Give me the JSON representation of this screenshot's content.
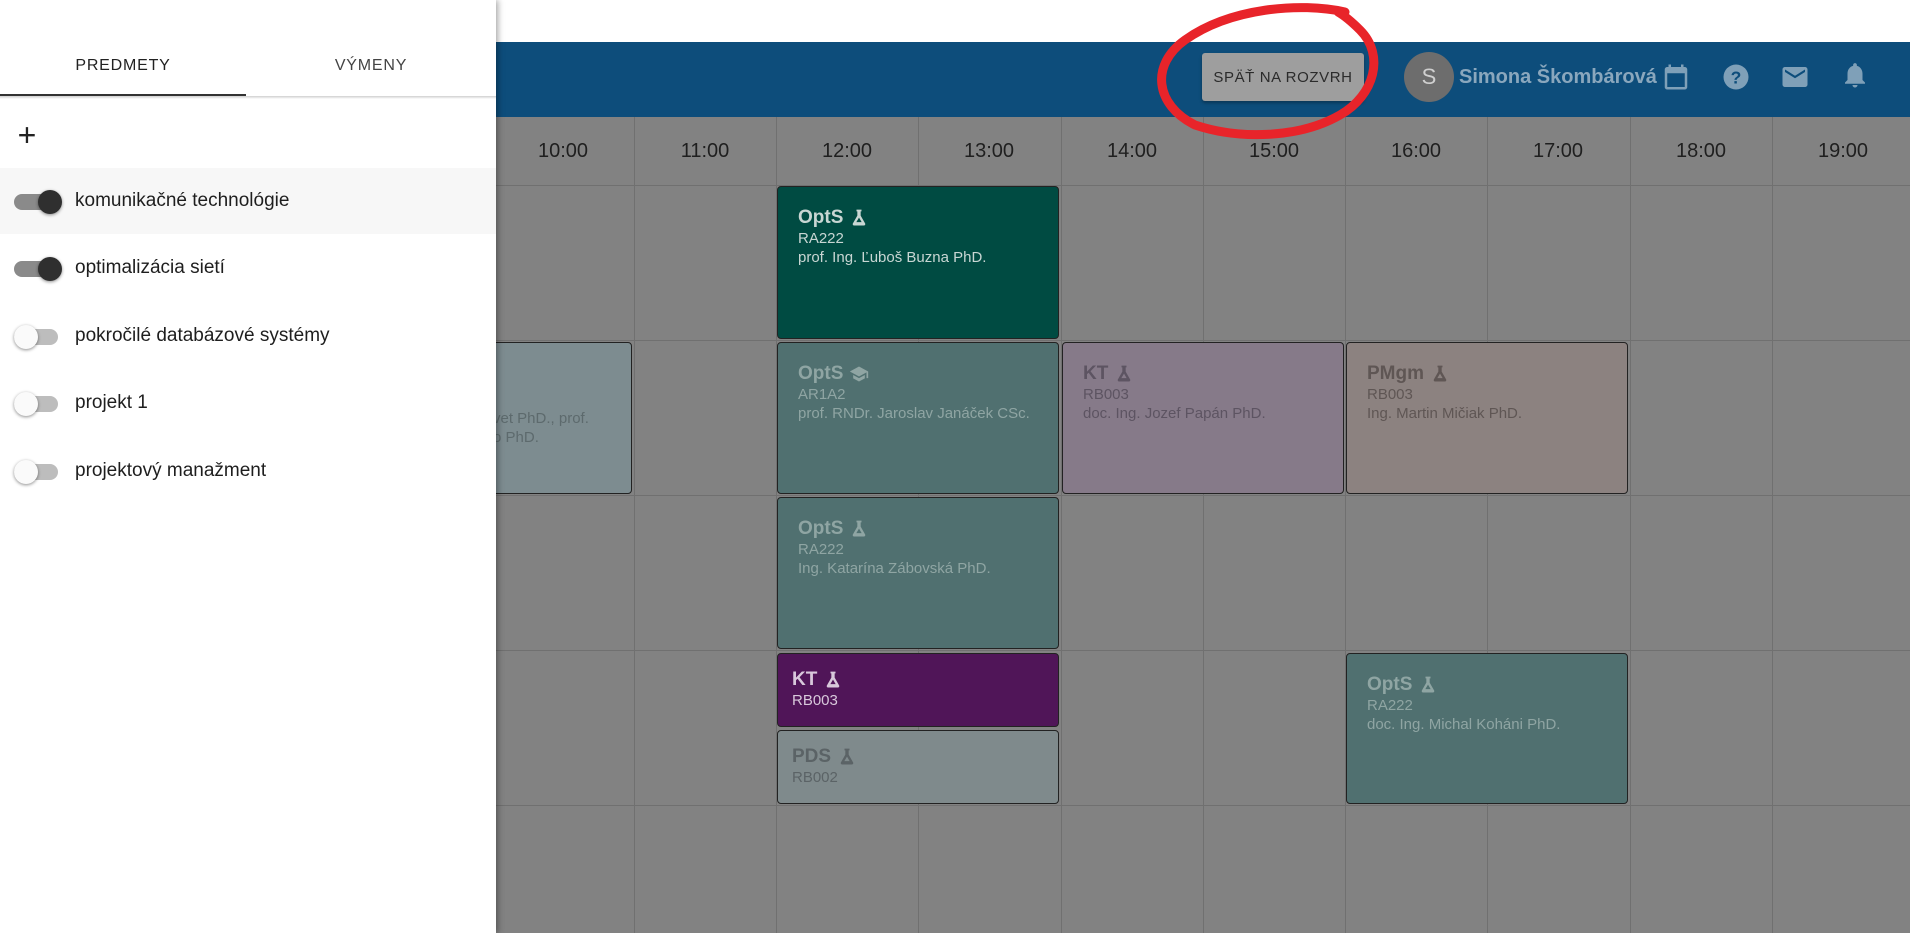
{
  "header": {
    "back_label": "SPÄŤ NA ROZVRH",
    "user_initial": "S",
    "user_name": "Simona Škombárová",
    "icons": [
      "calendar-icon",
      "help-icon",
      "mail-icon",
      "bell-icon"
    ],
    "bar_color": "#0d4d7b"
  },
  "drawer": {
    "tabs": [
      {
        "label": "PREDMETY",
        "active": true
      },
      {
        "label": "VÝMENY",
        "active": false
      }
    ],
    "add_label": "+",
    "subjects": [
      {
        "label": "komunikačné technológie",
        "enabled": true
      },
      {
        "label": "optimalizácia sietí",
        "enabled": true
      },
      {
        "label": "pokročilé databázové systémy",
        "enabled": false
      },
      {
        "label": "projekt 1",
        "enabled": false
      },
      {
        "label": "projektový manažment",
        "enabled": false
      }
    ]
  },
  "timetable": {
    "hours": [
      "10:00",
      "11:00",
      "12:00",
      "13:00",
      "14:00",
      "15:00",
      "16:00",
      "17:00",
      "18:00",
      "19:00"
    ],
    "events": [
      {
        "title": "OptS",
        "icon": "flask-icon",
        "room": "RA222",
        "teacher": "prof. Ing. Ľuboš Buzna PhD.",
        "bg": "#004b42",
        "fg": "#c8d6d3"
      },
      {
        "title": "OptS",
        "icon": "graduation-cap-icon",
        "room": "AR1A2",
        "teacher": "prof. RNDr. Jaroslav Janáček CSc.",
        "bg": "#507070",
        "fg": "#8fa5a3"
      },
      {
        "title": "KT",
        "icon": "flask-icon",
        "room": "RB003",
        "teacher": "doc. Ing. Jozef Papán PhD.",
        "bg": "#867a89",
        "fg": "#5d5462"
      },
      {
        "title": "PMgm",
        "icon": "flask-icon",
        "room": "RB003",
        "teacher": "Ing. Martin Mičiak PhD.",
        "bg": "#8c8280",
        "fg": "#5f5654"
      },
      {
        "title": "OptS",
        "icon": "flask-icon",
        "room": "RA222",
        "teacher": "Ing. Katarína Zábovská PhD.",
        "bg": "#507070",
        "fg": "#8fa5a3"
      },
      {
        "title": "KT",
        "icon": "flask-icon",
        "room": "RB003",
        "teacher": "",
        "bg": "#501558",
        "fg": "#d8c8db"
      },
      {
        "title": "PDS",
        "icon": "flask-icon",
        "room": "RB002",
        "teacher": "",
        "bg": "#7f8a8c",
        "fg": "#5b6366"
      },
      {
        "title": "OptS",
        "icon": "flask-icon",
        "room": "RA222",
        "teacher": "doc. Ing. Michal Koháni PhD.",
        "bg": "#507070",
        "fg": "#8fa5a3"
      }
    ],
    "partial_event": {
      "lines": [
        "vet PhD., prof.",
        "o PhD."
      ],
      "bg": "#7d8c90",
      "fg": "#5d6a6d"
    }
  }
}
